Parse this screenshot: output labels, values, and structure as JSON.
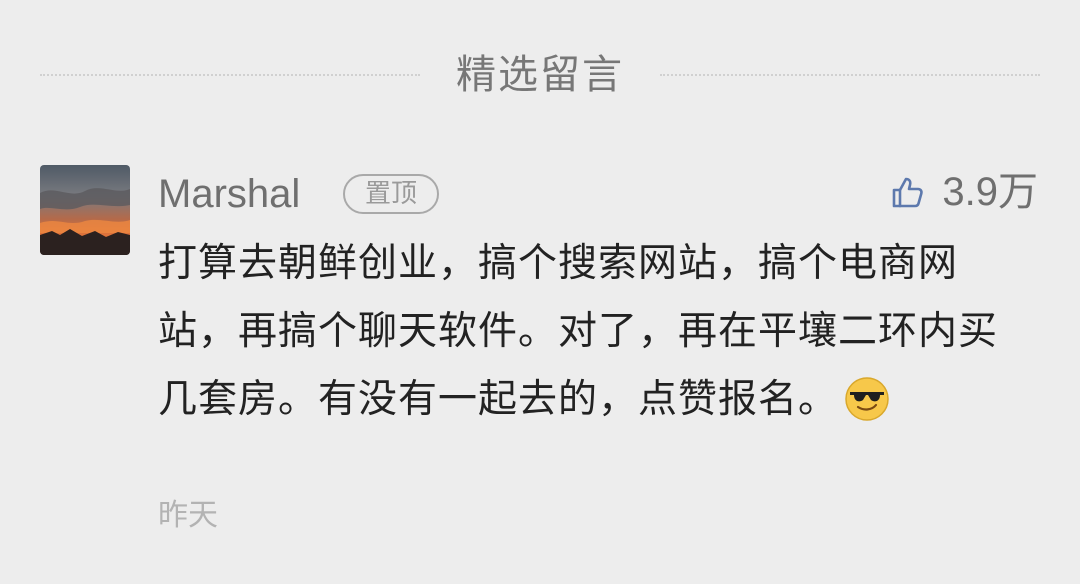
{
  "section": {
    "title": "精选留言"
  },
  "comment": {
    "username": "Marshal",
    "badge": "置顶",
    "likes": "3.9万",
    "text": "打算去朝鲜创业，搞个搜索网站，搞个电商网站，再搞个聊天软件。对了，再在平壤二环内买几套房。有没有一起去的，点赞报名。",
    "emoji": "sunglasses-emoji",
    "timestamp": "昨天"
  },
  "icons": {
    "like": "thumbs-up-icon"
  },
  "colors": {
    "background": "#ededed",
    "primary_text": "#222222",
    "secondary_text": "#6f6f6f",
    "muted_text": "#b3b3b3",
    "like_icon": "#5d79ad"
  }
}
